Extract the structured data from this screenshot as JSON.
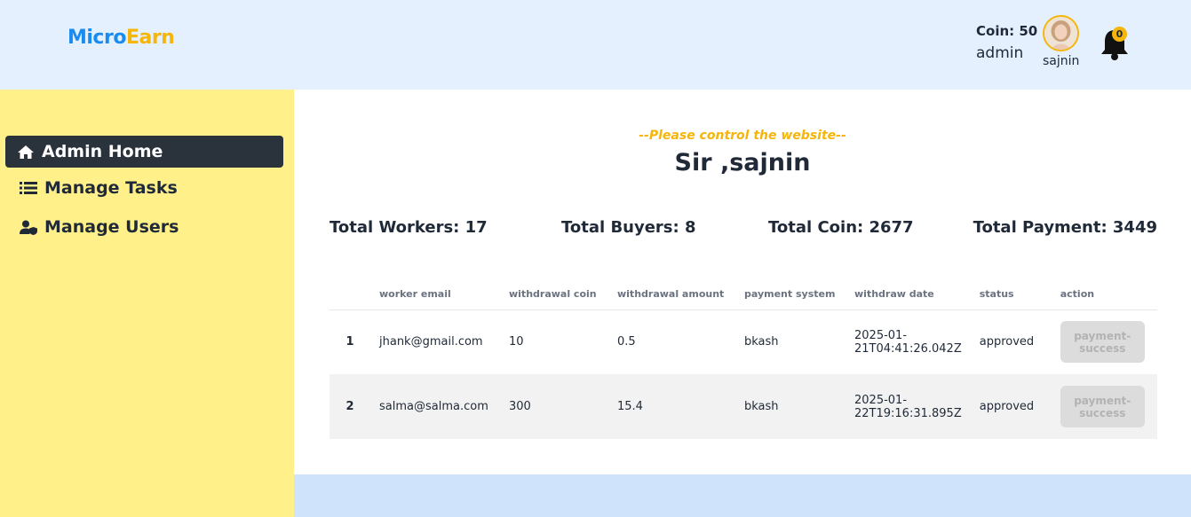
{
  "brand": {
    "part1": "Micro",
    "part2": "Earn"
  },
  "header": {
    "coin_label": "Coin: 50",
    "role": "admin",
    "username": "sajnin",
    "notification_count": "0"
  },
  "sidebar": {
    "items": [
      {
        "label": "Admin Home",
        "icon": "home-icon",
        "active": true
      },
      {
        "label": "Manage Tasks",
        "icon": "list-icon",
        "active": false
      },
      {
        "label": "Manage Users",
        "icon": "user-shield-icon",
        "active": false
      }
    ]
  },
  "main": {
    "tagline": "--Please control the website--",
    "greeting": "Sir ,sajnin",
    "stats": {
      "workers": "Total Workers: 17",
      "buyers": "Total Buyers: 8",
      "coin": "Total Coin: 2677",
      "payment": "Total Payment: 3449"
    },
    "table": {
      "headers": [
        "",
        "worker email",
        "withdrawal coin",
        "withdrawal amount",
        "payment system",
        "withdraw date",
        "status",
        "action"
      ],
      "rows": [
        {
          "num": "1",
          "email": "jhank@gmail.com",
          "coin": "10",
          "amount": "0.5",
          "system": "bkash",
          "date_line1": "2025-01-",
          "date_line2": "21T04:41:26.042Z",
          "status": "approved",
          "action": "payment-success"
        },
        {
          "num": "2",
          "email": "salma@salma.com",
          "coin": "300",
          "amount": "15.4",
          "system": "bkash",
          "date_line1": "2025-01-",
          "date_line2": "22T19:16:31.895Z",
          "status": "approved",
          "action": "payment-success"
        }
      ]
    }
  },
  "colors": {
    "header_bg": "#e4f0fd",
    "sidebar_bg": "#fff08a",
    "brand_blue": "#1a8cf0",
    "brand_yellow": "#f5b50a",
    "active_nav": "#2a323c"
  }
}
